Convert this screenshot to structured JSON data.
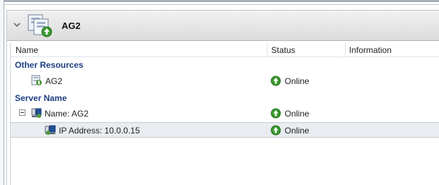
{
  "header": {
    "title": "AG2"
  },
  "columns": {
    "name": "Name",
    "status": "Status",
    "information": "Information"
  },
  "groups": [
    {
      "label": "Other Resources",
      "rows": [
        {
          "name": "AG2",
          "status": "Online",
          "information": ""
        }
      ]
    },
    {
      "label": "Server Name",
      "rows": [
        {
          "name": "Name: AG2",
          "status": "Online",
          "information": ""
        },
        {
          "name": "IP Address: 10.0.0.15",
          "status": "Online",
          "information": ""
        }
      ]
    }
  ],
  "icons": {
    "collapse": "chevron-down-icon",
    "header": "cluster-role-icon",
    "status": "online-arrow-icon",
    "resource": "resource-icon",
    "network_name": "network-name-icon",
    "ip_address": "ip-address-icon"
  },
  "colors": {
    "group_label": "#1d3e82",
    "online": "#3a9a2e",
    "selected_row": "#e9ecf0"
  }
}
